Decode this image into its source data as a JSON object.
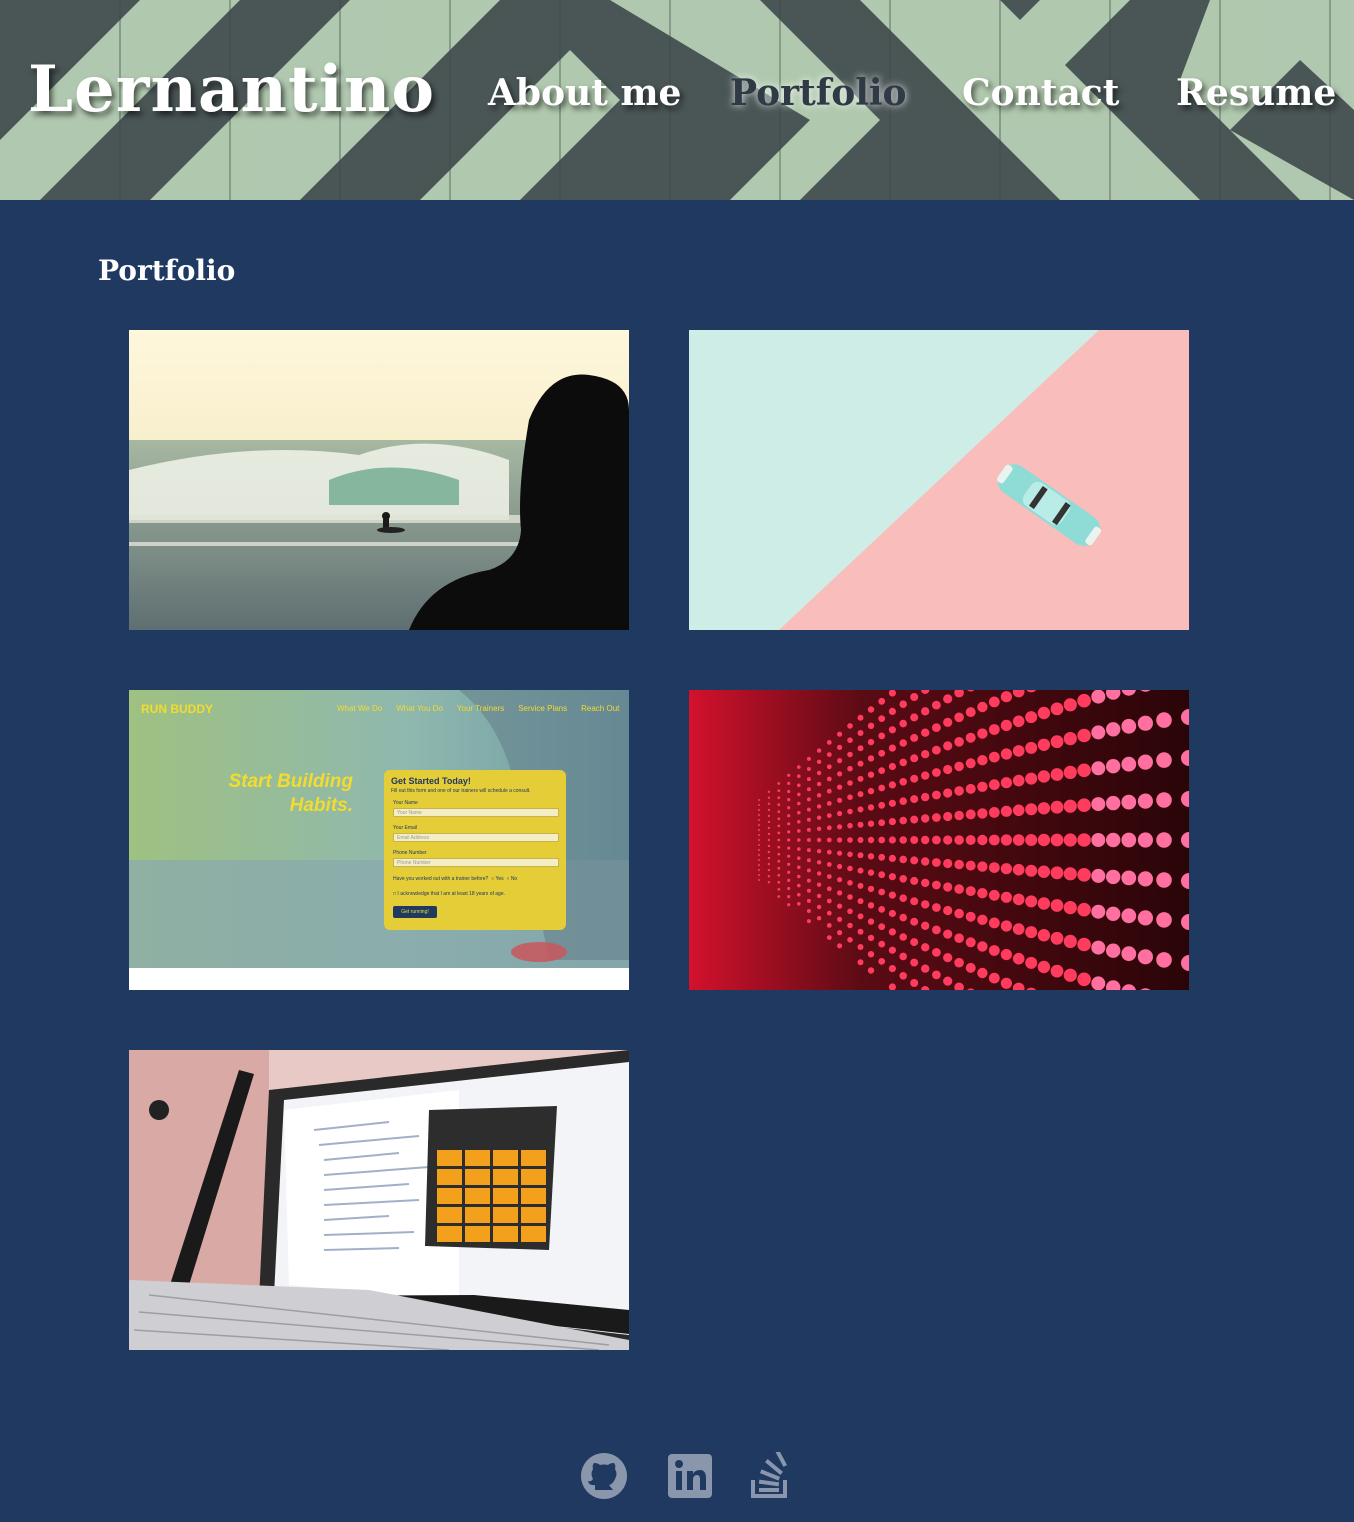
{
  "header": {
    "brand": "Lernantino",
    "nav": [
      {
        "label": "About me"
      },
      {
        "label": "Portfolio"
      },
      {
        "label": "Contact"
      },
      {
        "label": "Resume"
      }
    ]
  },
  "portfolio": {
    "title": "Portfolio",
    "runbuddy": {
      "logo": "RUN BUDDY",
      "nav": [
        "What We Do",
        "What You Do",
        "Your Trainers",
        "Service Plans",
        "Reach Out"
      ],
      "headline1": "Start Building",
      "headline2": "Habits.",
      "form_title": "Get Started Today!",
      "form_sub": "Fill out this form and one of our trainers will schedule a consult.",
      "name_label": "Your Name",
      "name_placeholder": "Your Name",
      "email_label": "Your Email",
      "email_placeholder": "Email Address",
      "phone_label": "Phone Number",
      "phone_placeholder": "Phone Number",
      "question": "Have you worked out with a trainer before?",
      "yes": "Yes",
      "no": "No",
      "ack": "I acknowledge that I am at least 18 years of age.",
      "button": "Get running!"
    }
  },
  "footer": {
    "icons": [
      "github-icon",
      "linkedin-icon",
      "stackoverflow-icon"
    ]
  },
  "colors": {
    "page_bg": "#1f3961",
    "header_stripe_light": "#b9d3b6",
    "header_stripe_dark": "#4a5556"
  }
}
